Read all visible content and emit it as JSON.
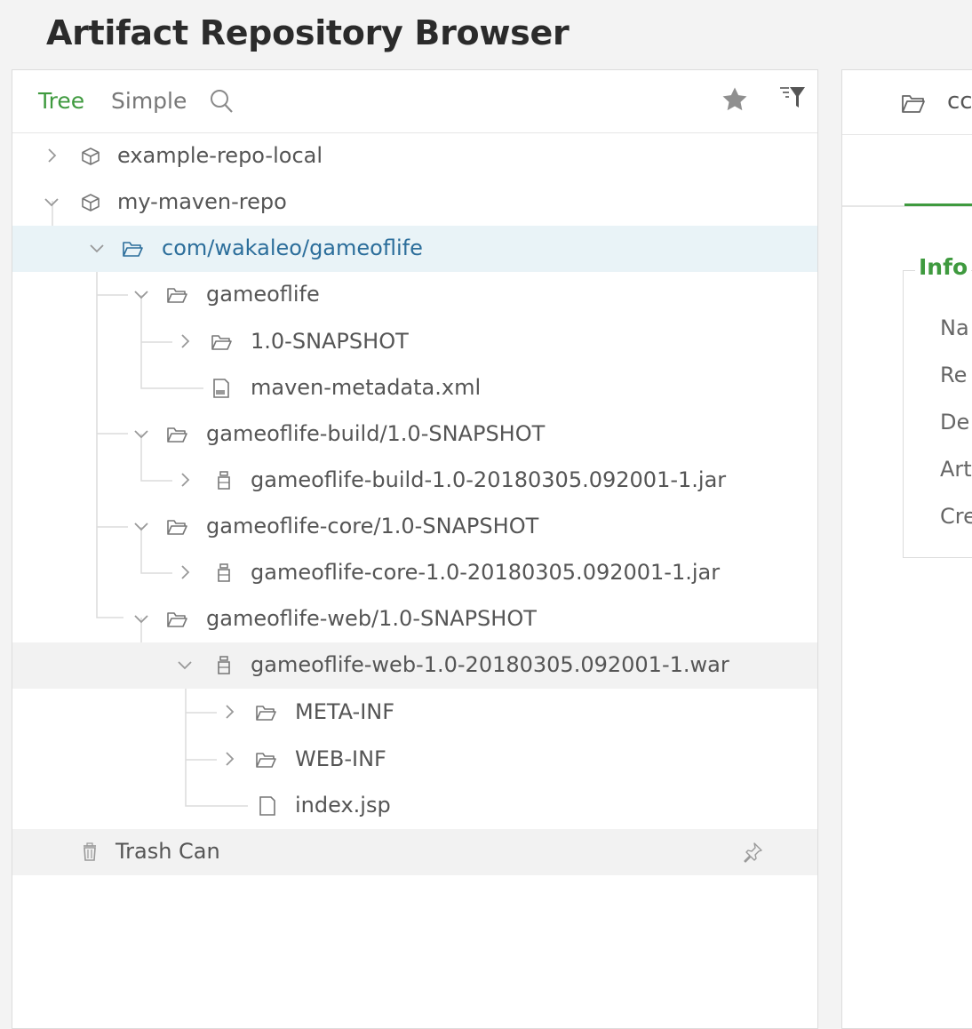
{
  "page": {
    "title": "Artifact Repository Browser"
  },
  "toolbar": {
    "tabs": [
      {
        "label": "Tree",
        "active": true
      },
      {
        "label": "Simple",
        "active": false
      }
    ],
    "search_icon": "search-icon",
    "favorites_icon": "star-icon",
    "filter_icon": "filter-icon"
  },
  "tree": {
    "items": [
      {
        "label": "example-repo-local",
        "icon": "repo-icon",
        "expanded": false
      },
      {
        "label": "my-maven-repo",
        "icon": "repo-icon",
        "expanded": true
      },
      {
        "label": "com/wakaleo/gameoflife",
        "icon": "folder-icon",
        "expanded": true,
        "selected": true
      },
      {
        "label": "gameoflife",
        "icon": "folder-icon",
        "expanded": true
      },
      {
        "label": "1.0-SNAPSHOT",
        "icon": "folder-icon",
        "expanded": false
      },
      {
        "label": "maven-metadata.xml",
        "icon": "xml-file-icon"
      },
      {
        "label": "gameoflife-build/1.0-SNAPSHOT",
        "icon": "folder-icon",
        "expanded": true
      },
      {
        "label": "gameoflife-build-1.0-20180305.092001-1.jar",
        "icon": "jar-icon",
        "expanded": false
      },
      {
        "label": "gameoflife-core/1.0-SNAPSHOT",
        "icon": "folder-icon",
        "expanded": true
      },
      {
        "label": "gameoflife-core-1.0-20180305.092001-1.jar",
        "icon": "jar-icon",
        "expanded": false
      },
      {
        "label": "gameoflife-web/1.0-SNAPSHOT",
        "icon": "folder-icon",
        "expanded": true
      },
      {
        "label": "gameoflife-web-1.0-20180305.092001-1.war",
        "icon": "jar-icon",
        "expanded": true
      },
      {
        "label": "META-INF",
        "icon": "folder-icon",
        "expanded": false
      },
      {
        "label": "WEB-INF",
        "icon": "folder-icon",
        "expanded": false
      },
      {
        "label": "index.jsp",
        "icon": "file-icon"
      }
    ],
    "trash": {
      "label": "Trash Can",
      "icon": "trash-icon",
      "pin_icon": "pin-icon"
    }
  },
  "details": {
    "header_title": "cc",
    "info_title": "Info",
    "fields": [
      "Na",
      "Re",
      "De",
      "Art",
      "Cre"
    ]
  },
  "colors": {
    "accent": "#3f9a3f",
    "selected_bg": "#e9f3f7",
    "selected_text": "#2c6e9b",
    "hover_bg": "#f2f2f2"
  }
}
